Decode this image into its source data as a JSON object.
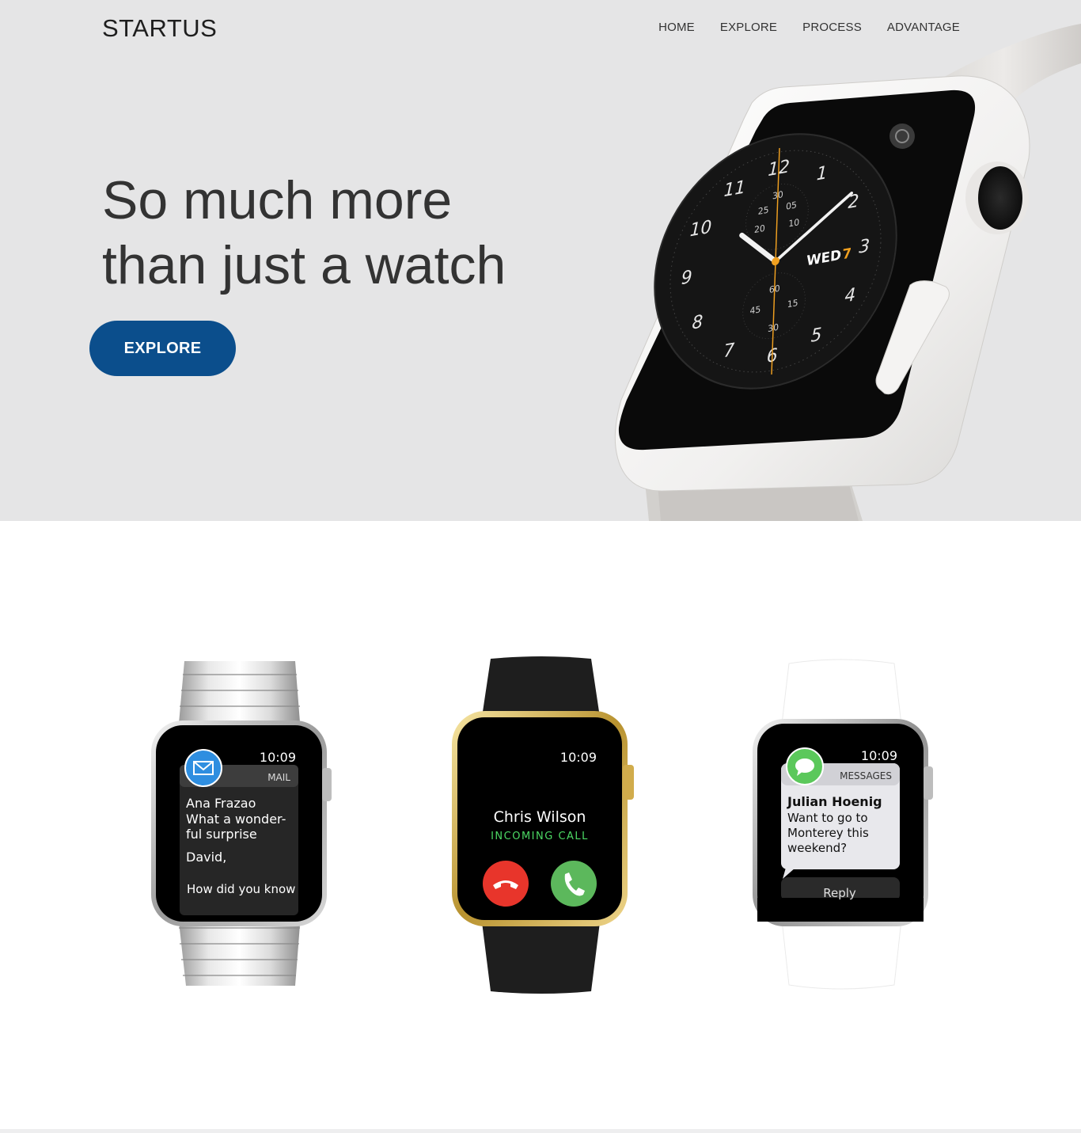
{
  "brand": {
    "name": "STARTUS"
  },
  "nav": {
    "items": [
      {
        "label": "HOME"
      },
      {
        "label": "EXPLORE"
      },
      {
        "label": "PROCESS"
      },
      {
        "label": "ADVANTAGE"
      }
    ]
  },
  "hero": {
    "headline_line1": "So much more",
    "headline_line2": "than just a watch",
    "cta_label": "EXPLORE",
    "cta_color": "#0b4e8c",
    "background": "#e5e5e6",
    "watch_face": {
      "numbers": [
        "12",
        "1",
        "2",
        "3",
        "4",
        "5",
        "6",
        "7",
        "8",
        "9",
        "10",
        "11"
      ],
      "date_day": "WED",
      "date_num": "7",
      "subdial_top": [
        "30",
        "25",
        "05",
        "20",
        "10"
      ],
      "subdial_bottom": [
        "60",
        "45",
        "15",
        "30"
      ]
    }
  },
  "products": {
    "watches": [
      {
        "time": "10:09",
        "app": "MAIL",
        "sender": "Ana Frazao",
        "subject_line1": "What a wonder-",
        "subject_line2": "ful surprise",
        "body_line1": "David,",
        "body_line2": "How did you know"
      },
      {
        "time": "10:09",
        "caller": "Chris Wilson",
        "status": "INCOMING CALL",
        "status_color": "#4cd964"
      },
      {
        "time": "10:09",
        "app": "MESSAGES",
        "sender": "Julian Hoenig",
        "msg_line1": "Want to go to",
        "msg_line2": "Monterey this",
        "msg_line3": "weekend?",
        "reply_label": "Reply"
      }
    ]
  }
}
